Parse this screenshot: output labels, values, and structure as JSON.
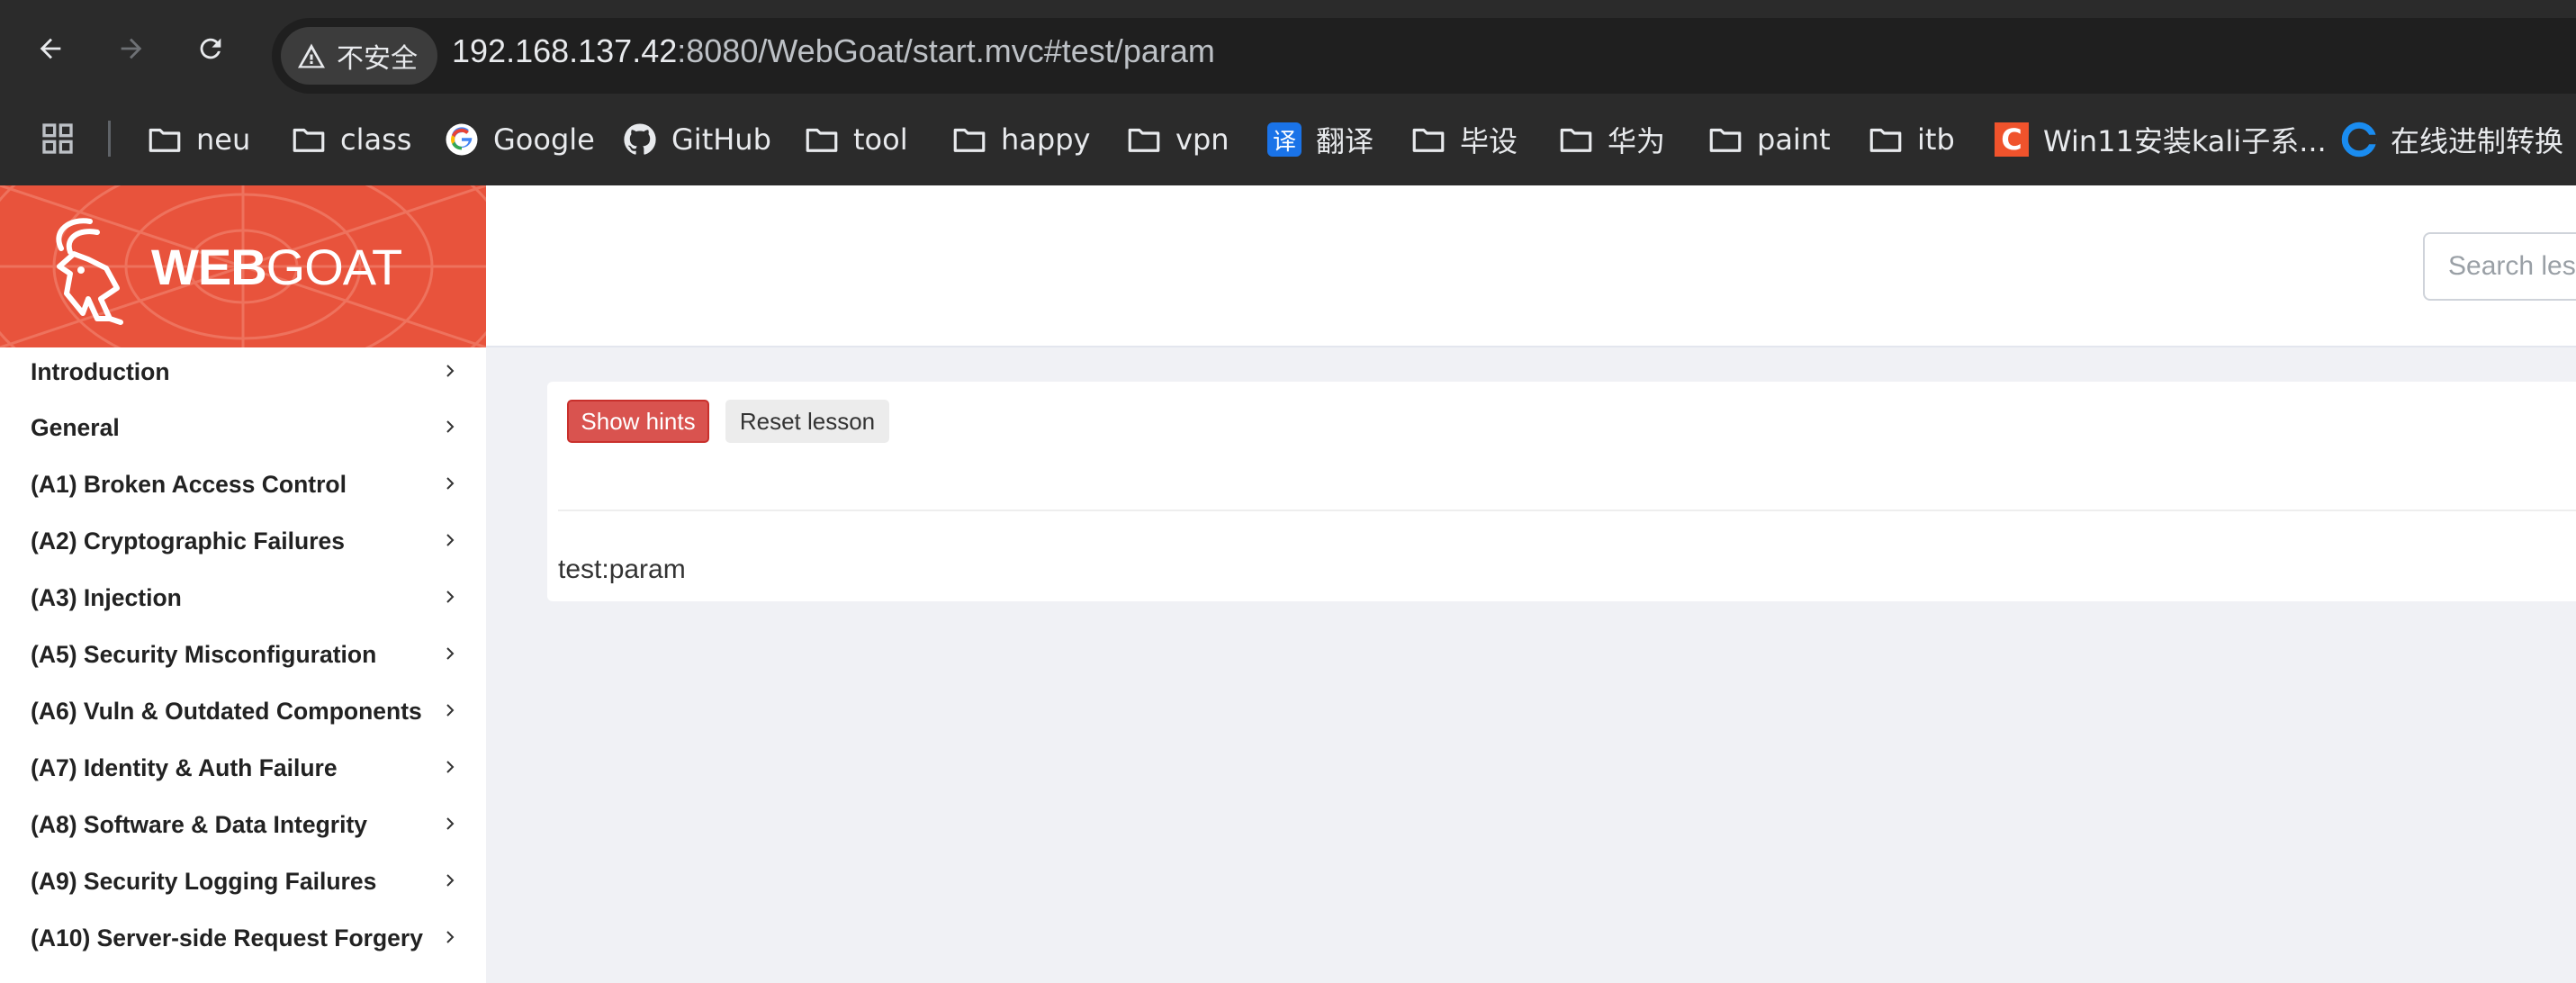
{
  "browser": {
    "security_label": "不安全",
    "url_host": "192.168.137.42",
    "url_rest": ":8080/WebGoat/start.mvc#test/param"
  },
  "bookmarks": [
    {
      "label": "neu",
      "icon": "folder-icon"
    },
    {
      "label": "class",
      "icon": "folder-icon"
    },
    {
      "label": "Google",
      "icon": "google-icon"
    },
    {
      "label": "GitHub",
      "icon": "github-icon"
    },
    {
      "label": "tool",
      "icon": "folder-icon"
    },
    {
      "label": "happy",
      "icon": "folder-icon"
    },
    {
      "label": "vpn",
      "icon": "folder-icon"
    },
    {
      "label": "翻译",
      "icon": "translate-icon",
      "icon_text": "译"
    },
    {
      "label": "毕设",
      "icon": "folder-icon"
    },
    {
      "label": "华为",
      "icon": "folder-icon"
    },
    {
      "label": "paint",
      "icon": "folder-icon"
    },
    {
      "label": "itb",
      "icon": "folder-icon"
    },
    {
      "label": "Win11安装kali子系...",
      "icon": "csdn-icon",
      "icon_text": "C"
    },
    {
      "label": "在线进制转换",
      "icon": "converter-icon"
    }
  ],
  "logo": {
    "bold": "WEB",
    "light": "GOAT"
  },
  "search": {
    "placeholder": "Search lessons"
  },
  "sidebar": {
    "items": [
      {
        "label": "Introduction"
      },
      {
        "label": "General"
      },
      {
        "label": "(A1) Broken Access Control"
      },
      {
        "label": "(A2) Cryptographic Failures"
      },
      {
        "label": "(A3) Injection"
      },
      {
        "label": "(A5) Security Misconfiguration"
      },
      {
        "label": "(A6) Vuln & Outdated Components"
      },
      {
        "label": "(A7) Identity & Auth Failure"
      },
      {
        "label": "(A8) Software & Data Integrity"
      },
      {
        "label": "(A9) Security Logging Failures"
      },
      {
        "label": "(A10) Server-side Request Forgery"
      }
    ]
  },
  "lesson": {
    "show_hints": "Show hints",
    "reset_lesson": "Reset lesson",
    "content": "test:param"
  },
  "colors": {
    "brand": "#e8533c",
    "hints_button": "#d9534f",
    "page_background": "#f0f1f5",
    "chrome": "#2b2b2b"
  }
}
